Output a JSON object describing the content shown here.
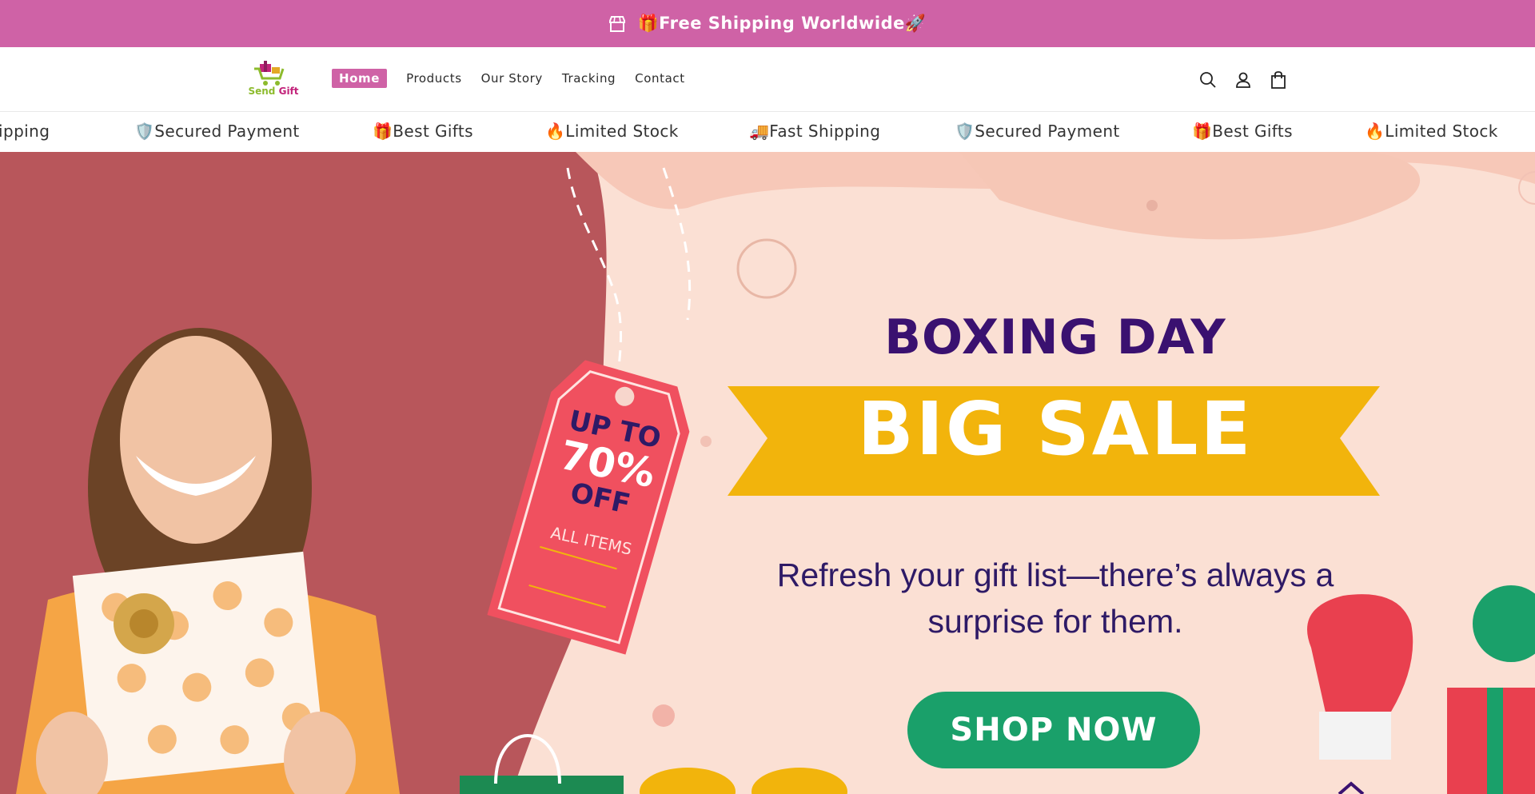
{
  "announcement": {
    "text": "🎁Free Shipping Worldwide🚀"
  },
  "logo": {
    "part1": "Send",
    "part2": "Gift"
  },
  "nav": {
    "items": [
      {
        "label": "Home"
      },
      {
        "label": "Products"
      },
      {
        "label": "Our Story"
      },
      {
        "label": "Tracking"
      },
      {
        "label": "Contact"
      }
    ]
  },
  "marquee": {
    "items": [
      "🚚Fast Shipping",
      "🛡️Secured Payment",
      "🎁Best Gifts",
      "🔥Limited Stock",
      "🚚Fast Shipping",
      "🛡️Secured Payment",
      "🎁Best Gifts",
      "🔥Limited Stock"
    ]
  },
  "hero": {
    "heading": "BOXING DAY",
    "banner": "BIG SALE",
    "tag_line1": "UP TO",
    "tag_line2": "70%",
    "tag_line3": "OFF",
    "tag_line4": "ALL ITEMS",
    "subtitle_line1": "Refresh your gift list—there’s always a",
    "subtitle_line2": "surprise for them.",
    "cta": "SHOP NOW"
  },
  "colors": {
    "accent": "#cf62a6",
    "cta": "#1aa06a",
    "banner": "#f2b40c",
    "heading": "#3a1170"
  }
}
